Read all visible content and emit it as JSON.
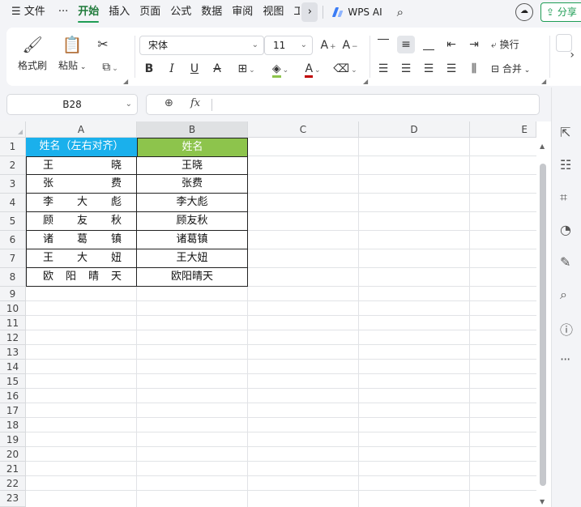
{
  "menubar": {
    "menu_icon": "☰",
    "file": "文件",
    "more": "···",
    "tabs": [
      "开始",
      "插入",
      "页面",
      "公式",
      "数据",
      "审阅",
      "视图",
      "工"
    ],
    "active_tab": "开始",
    "wps_ai": "WPS AI",
    "share": "分享",
    "accent": "#1f9d55"
  },
  "ribbon": {
    "format_painter": "格式刷",
    "paste": "粘贴",
    "font_name": "宋体",
    "font_size": "11",
    "wrap": "换行",
    "merge": "合并"
  },
  "formula_bar": {
    "name_box": "B28",
    "fx": "fx",
    "formula": ""
  },
  "sheet": {
    "columns": [
      "A",
      "B",
      "C",
      "D",
      "E"
    ],
    "rows": [
      "1",
      "2",
      "3",
      "4",
      "5",
      "6",
      "7",
      "8",
      "9",
      "10",
      "11",
      "12",
      "13",
      "14",
      "15",
      "16",
      "17",
      "18",
      "19",
      "20",
      "21",
      "22",
      "23"
    ],
    "header_a": "姓名（左右对齐）",
    "header_b": "姓名",
    "header_a_color": "#1ab0ec",
    "header_b_color": "#8dc44c",
    "names_a": [
      [
        "王",
        "晓"
      ],
      [
        "张",
        "费"
      ],
      [
        "李",
        "大",
        "彪"
      ],
      [
        "顾",
        "友",
        "秋"
      ],
      [
        "诸",
        "葛",
        "镇"
      ],
      [
        "王",
        "大",
        "妞"
      ],
      [
        "欧",
        "阳",
        "晴",
        "天"
      ]
    ],
    "names_b": [
      "王晓",
      "张费",
      "李大彪",
      "顾友秋",
      "诸葛镇",
      "王大妞",
      "欧阳晴天"
    ]
  }
}
